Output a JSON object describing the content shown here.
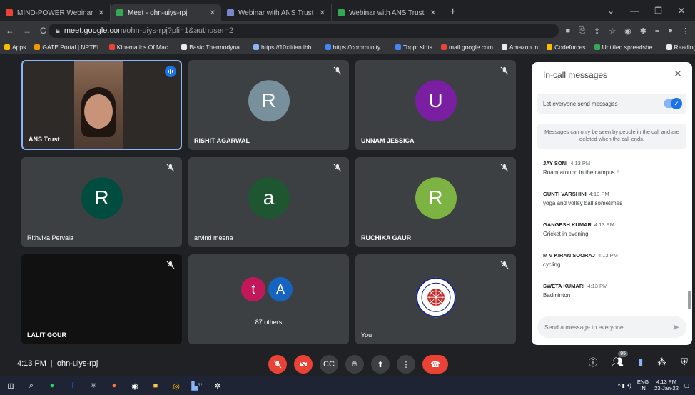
{
  "browser": {
    "tabs": [
      {
        "label": "MIND-POWER Webinar with ANS",
        "fav_color": "#ea4335",
        "active": false
      },
      {
        "label": "Meet - ohn-uiys-rpj",
        "fav_color": "#34a853",
        "active": true
      },
      {
        "label": "Webinar with ANS Trust - Googl",
        "fav_color": "#7986cb",
        "active": false
      },
      {
        "label": "Webinar with ANS Trust (Respon",
        "fav_color": "#34a853",
        "active": false
      }
    ],
    "url_host": "meet.google.com",
    "url_path": "/ohn-uiys-rpj?pli=1&authuser=2",
    "bookmarks": [
      {
        "label": "Apps",
        "color": "#fbbc04"
      },
      {
        "label": "GATE Portal | NPTEL",
        "color": "#f29900"
      },
      {
        "label": "Kinematics Of Mac...",
        "color": "#ea4335"
      },
      {
        "label": "Basic Thermodyna...",
        "color": "#e8eaed"
      },
      {
        "label": "https://10xiitian.ibh...",
        "color": "#8ab4f8"
      },
      {
        "label": "https://community....",
        "color": "#4285f4"
      },
      {
        "label": "Toppr slots",
        "color": "#4285f4"
      },
      {
        "label": "mail.google.com",
        "color": "#ea4335"
      },
      {
        "label": "Amazon.in",
        "color": "#e8eaed"
      },
      {
        "label": "Codeforces",
        "color": "#fbbc04"
      },
      {
        "label": "Untitled spreadshe...",
        "color": "#34a853"
      },
      {
        "label": "Reading list",
        "color": "#e8eaed"
      }
    ]
  },
  "participants": [
    {
      "name": "ANS Trust",
      "type": "video",
      "speaking": true
    },
    {
      "name": "RISHIT AGARWAL",
      "initial": "R",
      "color": "#78909c",
      "muted": true
    },
    {
      "name": "UNNAM JESSICA",
      "initial": "U",
      "color": "#7b1fa2",
      "muted": true
    },
    {
      "name": "Rithvika Pervala",
      "initial": "R",
      "color": "#004d40",
      "muted": true
    },
    {
      "name": "arvind meena",
      "initial": "a",
      "color": "#1e5631",
      "muted": true
    },
    {
      "name": "RUCHIKA GAUR",
      "initial": "R",
      "color": "#7cb342",
      "muted": true
    },
    {
      "name": "LALIT GOUR",
      "type": "dark",
      "muted": true
    },
    {
      "name": "87 others",
      "type": "others",
      "avatars": [
        {
          "initial": "t",
          "color": "#c2185b"
        },
        {
          "initial": "A",
          "color": "#1565c0"
        }
      ]
    },
    {
      "name": "You",
      "type": "emblem",
      "muted": true
    }
  ],
  "chat": {
    "title": "In-call messages",
    "toggle_label": "Let everyone send messages",
    "toggle_on": true,
    "note": "Messages can only be seen by people in the call and are deleted when the call ends.",
    "messages": [
      {
        "sender": "JAY SONI",
        "time": "4:13 PM",
        "text": "Roam around in the campus !!"
      },
      {
        "sender": "GUNTI VARSHINI",
        "time": "4:13 PM",
        "text": "yoga and volley ball sometimes"
      },
      {
        "sender": "GANGESH KUMAR",
        "time": "4:13 PM",
        "text": "Cricket in evening"
      },
      {
        "sender": "M V KIRAN SOORAJ",
        "time": "4:13 PM",
        "text": "cycling"
      },
      {
        "sender": "SWETA KUMARI",
        "time": "4:13 PM",
        "text": "Badminton"
      }
    ],
    "input_placeholder": "Send a message to everyone"
  },
  "meeting": {
    "time": "4:13 PM",
    "code": "ohn-uiys-rpj",
    "people_count": "95"
  },
  "taskbar": {
    "lang": "ENG",
    "region": "IN",
    "time": "4:13 PM",
    "date": "23-Jan-22",
    "badge": "52"
  }
}
